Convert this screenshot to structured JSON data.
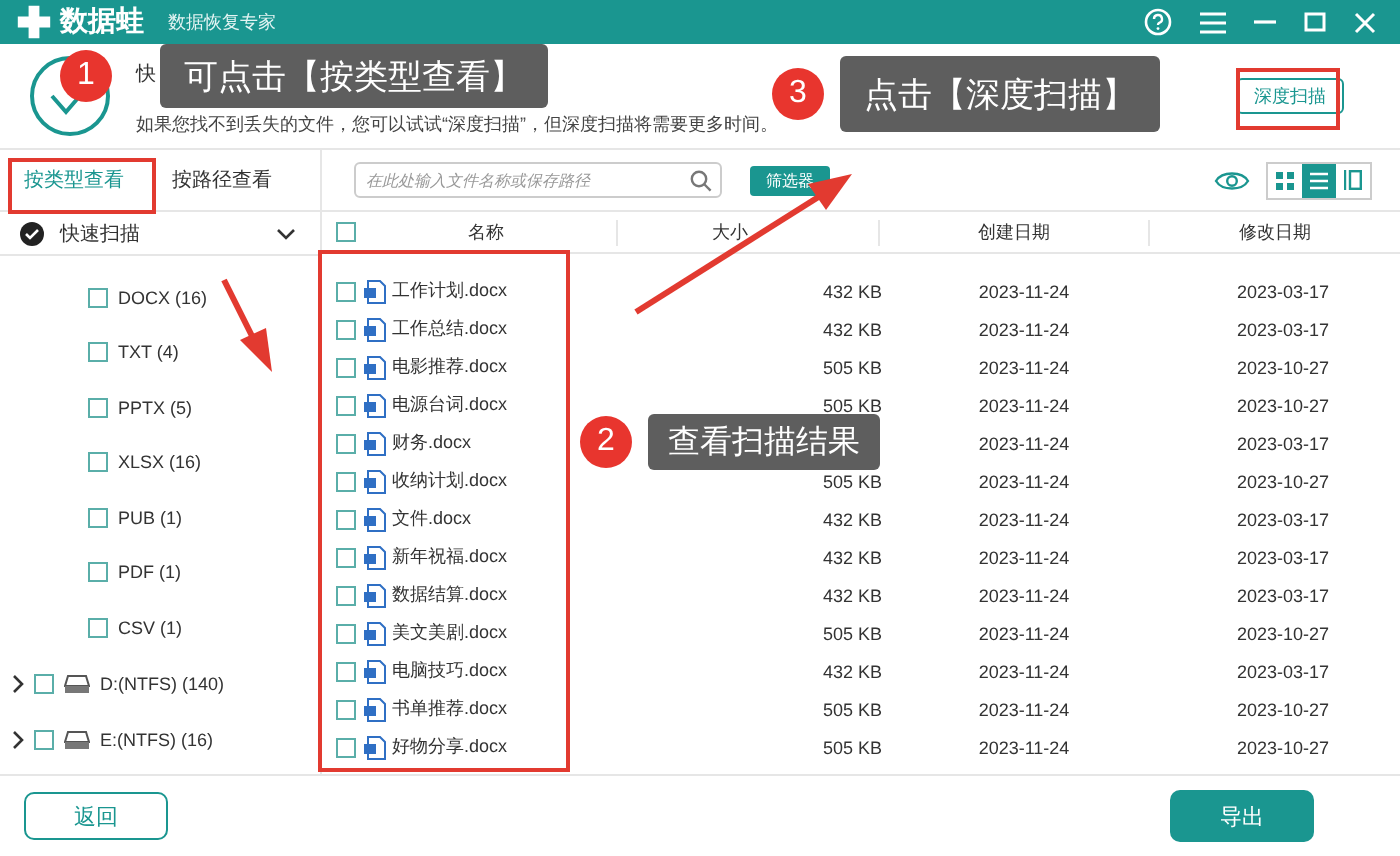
{
  "window": {
    "app_name": "数据蛙",
    "subtitle": "数据恢复专家"
  },
  "header": {
    "title": "快",
    "description": "如果您找不到丢失的文件，您可以试试“深度扫描”，但深度扫描将需要更多时间。",
    "deep_scan_button": "深度扫描"
  },
  "view_tabs": [
    {
      "label": "按类型查看",
      "selected": true
    },
    {
      "label": "按路径查看",
      "selected": false
    }
  ],
  "search": {
    "placeholder": "在此处输入文件名称或保存路径"
  },
  "filter_button": "筛选器",
  "view_modes": [
    {
      "kind": "grid",
      "selected": false
    },
    {
      "kind": "list",
      "selected": true
    },
    {
      "kind": "detail",
      "selected": false
    }
  ],
  "tree": [
    {
      "label": "快速扫描",
      "kind": "scan",
      "checked": true,
      "expanded": true,
      "children": [
        {
          "label": "DOCX (16)",
          "checked": false
        },
        {
          "label": "TXT (4)",
          "checked": false
        },
        {
          "label": "PPTX (5)",
          "checked": false
        },
        {
          "label": "XLSX (16)",
          "checked": false
        },
        {
          "label": "PUB (1)",
          "checked": false
        },
        {
          "label": "PDF (1)",
          "checked": false
        },
        {
          "label": "CSV (1)",
          "checked": false
        }
      ]
    },
    {
      "label": "D:(NTFS) (140)",
      "kind": "drive",
      "checked": false,
      "expanded": false
    },
    {
      "label": "E:(NTFS) (16)",
      "kind": "drive",
      "checked": false,
      "expanded": false
    }
  ],
  "table": {
    "select_all_checked": false,
    "columns": [
      "名称",
      "大小",
      "创建日期",
      "修改日期"
    ],
    "rows": [
      {
        "name": "工作计划.docx",
        "size": "432 KB",
        "created": "2023-11-24",
        "modified": "2023-03-17",
        "checked": false
      },
      {
        "name": "工作总结.docx",
        "size": "432 KB",
        "created": "2023-11-24",
        "modified": "2023-03-17",
        "checked": false
      },
      {
        "name": "电影推荐.docx",
        "size": "505 KB",
        "created": "2023-11-24",
        "modified": "2023-10-27",
        "checked": false
      },
      {
        "name": "电源台词.docx",
        "size": "505 KB",
        "created": "2023-11-24",
        "modified": "2023-10-27",
        "checked": false
      },
      {
        "name": "财务.docx",
        "created": "2023-11-24",
        "modified": "2023-03-17",
        "checked": false
      },
      {
        "name": "收纳计划.docx",
        "size": "505 KB",
        "created": "2023-11-24",
        "modified": "2023-10-27",
        "checked": false
      },
      {
        "name": "文件.docx",
        "size": "432 KB",
        "created": "2023-11-24",
        "modified": "2023-03-17",
        "checked": false
      },
      {
        "name": "新年祝福.docx",
        "size": "432 KB",
        "created": "2023-11-24",
        "modified": "2023-03-17",
        "checked": false
      },
      {
        "name": "数据结算.docx",
        "size": "432 KB",
        "created": "2023-11-24",
        "modified": "2023-03-17",
        "checked": false
      },
      {
        "name": "美文美剧.docx",
        "size": "505 KB",
        "created": "2023-11-24",
        "modified": "2023-10-27",
        "checked": false
      },
      {
        "name": "电脑技巧.docx",
        "size": "432 KB",
        "created": "2023-11-24",
        "modified": "2023-03-17",
        "checked": false
      },
      {
        "name": "书单推荐.docx",
        "size": "505 KB",
        "created": "2023-11-24",
        "modified": "2023-10-27",
        "checked": false
      },
      {
        "name": "好物分享.docx",
        "size": "505 KB",
        "created": "2023-11-24",
        "modified": "2023-10-27",
        "checked": false
      }
    ]
  },
  "buttons": {
    "back": "返回",
    "export": "导出"
  },
  "annotations": [
    {
      "number": "1",
      "text": "可点击【按类型查看】"
    },
    {
      "number": "2",
      "text": "查看扫描结果"
    },
    {
      "number": "3",
      "text": "点击【深度扫描】"
    }
  ]
}
